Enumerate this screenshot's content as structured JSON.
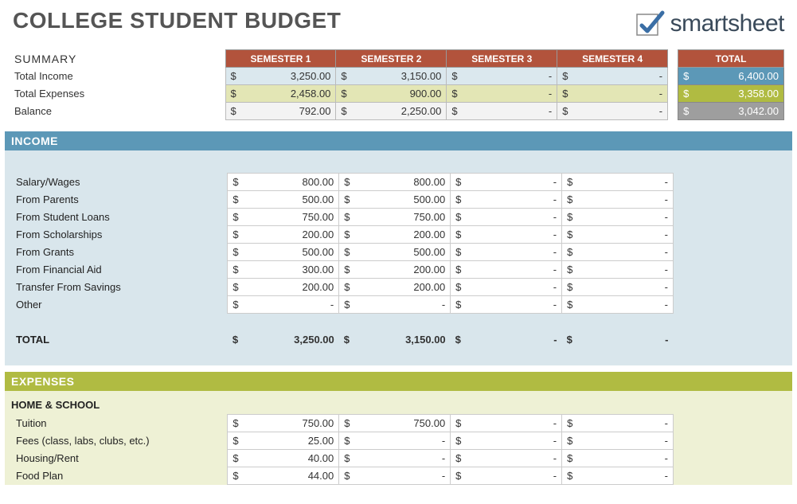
{
  "title": "COLLEGE STUDENT BUDGET",
  "logo_text": "smartsheet",
  "summary": {
    "heading": "SUMMARY",
    "semesters": [
      "SEMESTER 1",
      "SEMESTER 2",
      "SEMESTER 3",
      "SEMESTER 4"
    ],
    "rows": {
      "income": {
        "label": "Total Income",
        "vals": [
          "3,250.00",
          "3,150.00",
          "-",
          "-"
        ]
      },
      "expense": {
        "label": "Total Expenses",
        "vals": [
          "2,458.00",
          "900.00",
          "-",
          "-"
        ]
      },
      "balance": {
        "label": "Balance",
        "vals": [
          "792.00",
          "2,250.00",
          "-",
          "-"
        ]
      }
    },
    "total_header": "TOTAL",
    "totals": {
      "income": "6,400.00",
      "expense": "3,358.00",
      "balance": "3,042.00"
    }
  },
  "income_section": {
    "banner": "INCOME",
    "rows": [
      {
        "label": "Salary/Wages",
        "vals": [
          "800.00",
          "800.00",
          "-",
          "-"
        ]
      },
      {
        "label": "From Parents",
        "vals": [
          "500.00",
          "500.00",
          "-",
          "-"
        ]
      },
      {
        "label": "From Student Loans",
        "vals": [
          "750.00",
          "750.00",
          "-",
          "-"
        ]
      },
      {
        "label": "From Scholarships",
        "vals": [
          "200.00",
          "200.00",
          "-",
          "-"
        ]
      },
      {
        "label": "From Grants",
        "vals": [
          "500.00",
          "500.00",
          "-",
          "-"
        ]
      },
      {
        "label": "From Financial Aid",
        "vals": [
          "300.00",
          "200.00",
          "-",
          "-"
        ]
      },
      {
        "label": "Transfer From Savings",
        "vals": [
          "200.00",
          "200.00",
          "-",
          "-"
        ]
      },
      {
        "label": "Other",
        "vals": [
          "-",
          "-",
          "-",
          "-"
        ]
      }
    ],
    "total_label": "TOTAL",
    "total_vals": [
      "3,250.00",
      "3,150.00",
      "-",
      "-"
    ]
  },
  "expense_section": {
    "banner": "EXPENSES",
    "subhead": "HOME & SCHOOL",
    "rows": [
      {
        "label": "Tuition",
        "vals": [
          "750.00",
          "750.00",
          "-",
          "-"
        ]
      },
      {
        "label": "Fees (class, labs, clubs, etc.)",
        "vals": [
          "25.00",
          "-",
          "-",
          "-"
        ]
      },
      {
        "label": "Housing/Rent",
        "vals": [
          "40.00",
          "-",
          "-",
          "-"
        ]
      },
      {
        "label": "Food Plan",
        "vals": [
          "44.00",
          "-",
          "-",
          "-"
        ]
      }
    ]
  }
}
